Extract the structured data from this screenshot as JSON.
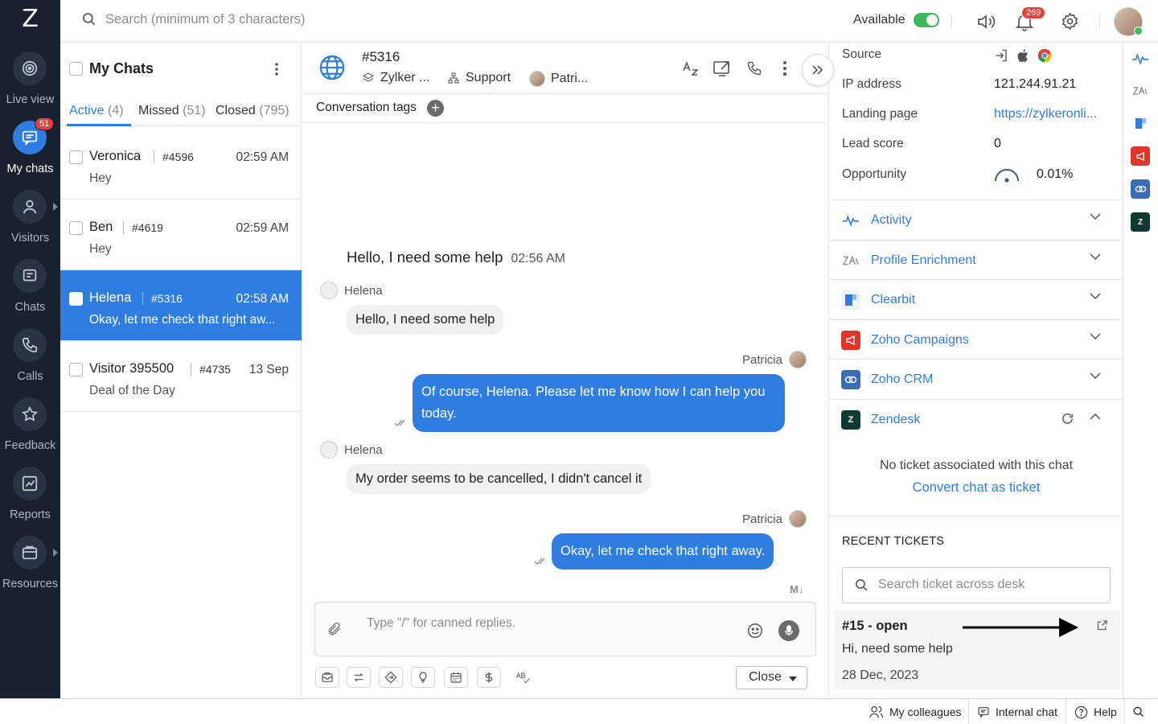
{
  "app": {
    "logo": "Z"
  },
  "nav": {
    "items": [
      {
        "label": "Live view",
        "icon": "live-view-icon"
      },
      {
        "label": "My chats",
        "icon": "chat-bubble-icon",
        "badge": "51",
        "active": true
      },
      {
        "label": "Visitors",
        "icon": "user-icon"
      },
      {
        "label": "Chats",
        "icon": "chats-icon"
      },
      {
        "label": "Calls",
        "icon": "phone-icon"
      },
      {
        "label": "Feedback",
        "icon": "star-icon"
      },
      {
        "label": "Reports",
        "icon": "chart-icon"
      },
      {
        "label": "Resources",
        "icon": "folder-icon"
      }
    ]
  },
  "topbar": {
    "search_placeholder": "Search (minimum of 3 characters)",
    "status": "Available",
    "notifications": "269"
  },
  "chatlist": {
    "title": "My Chats",
    "tabs": [
      {
        "label": "Active",
        "count": "(4)"
      },
      {
        "label": "Missed",
        "count": "(51)"
      },
      {
        "label": "Closed",
        "count": "(795)"
      }
    ],
    "chats": [
      {
        "name": "Veronica",
        "id": "#4596",
        "time": "02:59 AM",
        "message": "Hey"
      },
      {
        "name": "Ben",
        "id": "#4619",
        "time": "02:59 AM",
        "message": "Hey"
      },
      {
        "name": "Helena",
        "id": "#5316",
        "time": "02:58 AM",
        "message": "Okay, let me check that right aw...",
        "selected": true
      },
      {
        "name": "Visitor 395500",
        "id": "#4735",
        "time": "13 Sep",
        "message": "Deal of the Day"
      }
    ]
  },
  "conversation": {
    "id": "#5316",
    "brand": "Zylker ...",
    "department": "Support",
    "agent": "Patri...",
    "tags_label": "Conversation tags",
    "first_message": {
      "text": "Hello, I need some help",
      "time": "02:56 AM"
    },
    "messages": [
      {
        "sender": "Helena",
        "text": "Hello, I need some help"
      },
      {
        "sender": "Patricia",
        "text": "Of course, Helena. Please let me know how I can help you today."
      },
      {
        "sender": "Helena",
        "text": "My order seems to be cancelled, I didn't cancel it"
      },
      {
        "sender": "Patricia",
        "text": "Okay, let me check that right away."
      }
    ],
    "markdown_mark": "M↓",
    "composer_placeholder": "Type \"/\" for canned replies.",
    "close_label": "Close"
  },
  "visitor_info": {
    "source_label": "Source",
    "ip_label": "IP address",
    "ip_value": "121.244.91.21",
    "landing_label": "Landing page",
    "landing_value": "https://zylkeronli...",
    "lead_label": "Lead score",
    "lead_value": "0",
    "opportunity_label": "Opportunity",
    "opportunity_value": "0.01%"
  },
  "integrations": [
    {
      "label": "Activity",
      "color": "#2f7de1"
    },
    {
      "label": "Profile Enrichment",
      "color": "#888888"
    },
    {
      "label": "Clearbit",
      "color": "#2f7de1"
    },
    {
      "label": "Zoho Campaigns",
      "color": "#e2352a"
    },
    {
      "label": "Zoho CRM",
      "color": "#3b6db4"
    },
    {
      "label": "Zendesk",
      "color": "#0f3a33"
    }
  ],
  "zendesk": {
    "no_ticket": "No ticket associated with this chat",
    "convert_label": "Convert chat as ticket",
    "recent_title": "RECENT TICKETS",
    "search_placeholder": "Search ticket across desk",
    "ticket": {
      "title": "#15 - open",
      "message": "Hi, need some help",
      "date": "28 Dec, 2023"
    }
  },
  "bottombar": {
    "colleagues": "My colleagues",
    "internal": "Internal chat",
    "help": "Help"
  }
}
